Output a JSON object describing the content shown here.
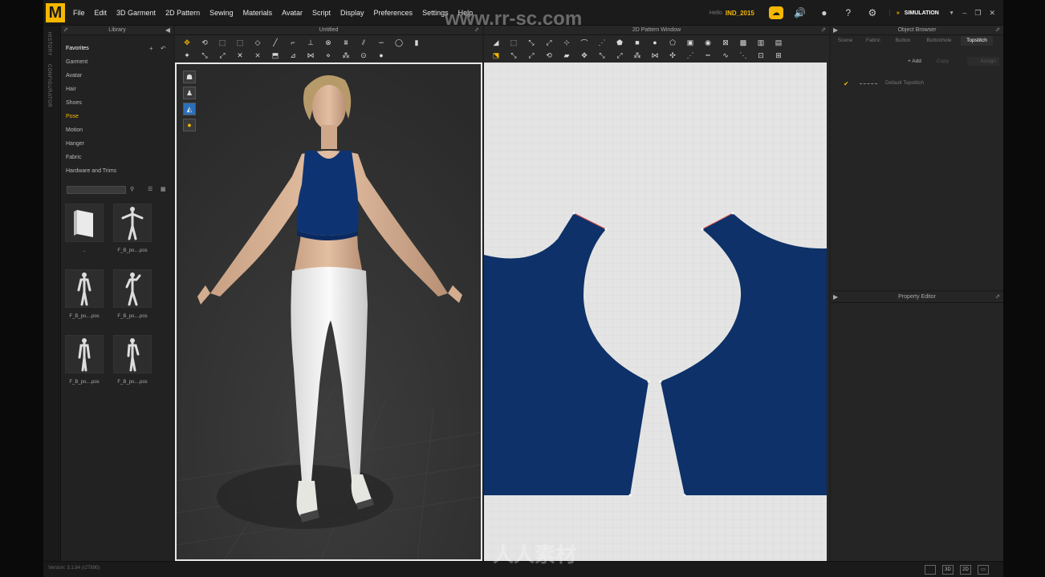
{
  "app": {
    "logo_letter": "M",
    "brand_color": "#f5b700",
    "menu": [
      "File",
      "Edit",
      "3D Garment",
      "2D Pattern",
      "Sewing",
      "Materials",
      "Avatar",
      "Script",
      "Display",
      "Preferences",
      "Settings",
      "Help"
    ],
    "hello_label": "Hello",
    "username": "IND_2015",
    "simulation_label": "SIMULATION",
    "icons": [
      "cloud-icon",
      "speaker-icon",
      "user-icon",
      "help-icon",
      "gear-icon",
      "simulation-chevron-icon"
    ]
  },
  "side_tabs": [
    "HISTORY",
    "CONFIGURATOR"
  ],
  "library": {
    "header": "Library",
    "items": [
      "Favorites",
      "Garment",
      "Avatar",
      "Hair",
      "Shoes",
      "Pose",
      "Motion",
      "Hanger",
      "Fabric",
      "Hardware and Trims"
    ],
    "active_item": "Pose",
    "thumbnails": [
      {
        "label": "..",
        "icon": "folder-icon"
      },
      {
        "label": "F_B_po....pos",
        "icon": "pose-icon"
      },
      {
        "label": "F_B_po....pos",
        "icon": "pose-icon"
      },
      {
        "label": "F_B_po....pos",
        "icon": "pose-icon"
      },
      {
        "label": "F_B_po....pos",
        "icon": "pose-icon"
      },
      {
        "label": "F_B_po....pos",
        "icon": "pose-icon"
      }
    ]
  },
  "window3d": {
    "title": "Untitled"
  },
  "window2d": {
    "title": "2D Pattern Window"
  },
  "object_browser": {
    "title": "Object Browser",
    "tabs": [
      "Scene",
      "Fabric",
      "Button",
      "Buttonhole",
      "Topstitch"
    ],
    "active_tab": "Topstitch",
    "add_label": "+ Add",
    "copy_label": "Copy",
    "assign_label": "Assign",
    "items": [
      "Default Topstitch"
    ]
  },
  "property_editor": {
    "title": "Property Editor"
  },
  "status": {
    "version": "Version: 3.1.84    (r27890)"
  },
  "view_buttons": [
    "",
    "3D",
    "2D"
  ],
  "watermark": {
    "url": "www.rr-sc.com",
    "cn": "人人素材"
  },
  "colors": {
    "garment": "#0d3373",
    "pattern": "#0d3168",
    "grid_bg": "#e4e4e4"
  }
}
